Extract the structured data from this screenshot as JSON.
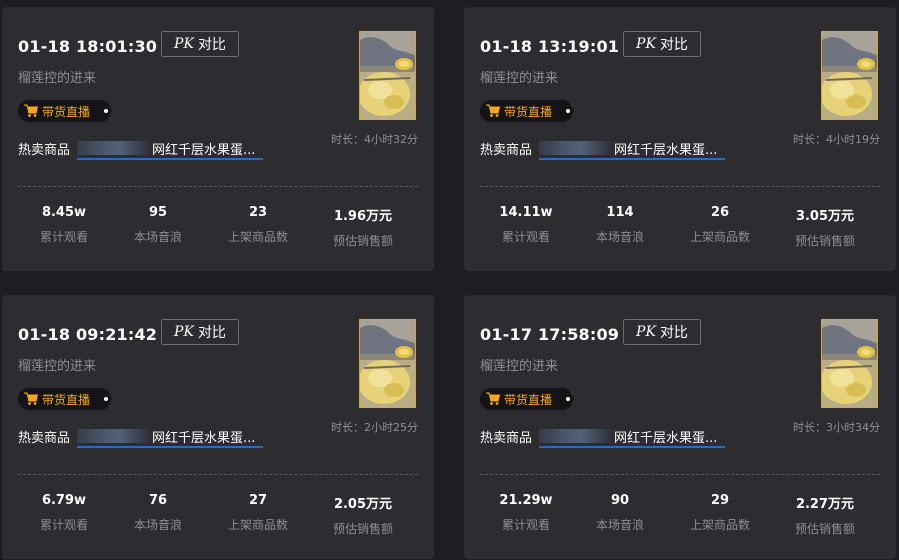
{
  "labels": {
    "pk_prefix": "PK",
    "pk_text": "对比",
    "badge": "带货直播",
    "hot": "热卖商品",
    "stat_viewers": "累计观看",
    "stat_gifts": "本场音浪",
    "stat_items": "上架商品数",
    "stat_sales": "预估销售额"
  },
  "colors": {
    "accent": "#f5a623",
    "link": "#2d6db8",
    "card_bg": "#2c2c31",
    "page_bg": "#1e1e22"
  },
  "cards": [
    {
      "time": "01-18 18:01:30",
      "subtitle": "榴莲控的进来",
      "product": "网红千层水果蛋...",
      "duration": "时长：4小时32分",
      "viewers": "8.45w",
      "gifts": "95",
      "items": "23",
      "sales": "1.96万元"
    },
    {
      "time": "01-18 13:19:01",
      "subtitle": "榴莲控的进来",
      "product": "网红千层水果蛋...",
      "duration": "时长：4小时19分",
      "viewers": "14.11w",
      "gifts": "114",
      "items": "26",
      "sales": "3.05万元"
    },
    {
      "time": "01-18 09:21:42",
      "subtitle": "榴莲控的进来",
      "product": "网红千层水果蛋...",
      "duration": "时长：2小时25分",
      "viewers": "6.79w",
      "gifts": "76",
      "items": "27",
      "sales": "2.05万元"
    },
    {
      "time": "01-17 17:58:09",
      "subtitle": "榴莲控的进来",
      "product": "网红千层水果蛋...",
      "duration": "时长：3小时34分",
      "viewers": "21.29w",
      "gifts": "90",
      "items": "29",
      "sales": "2.27万元"
    }
  ]
}
